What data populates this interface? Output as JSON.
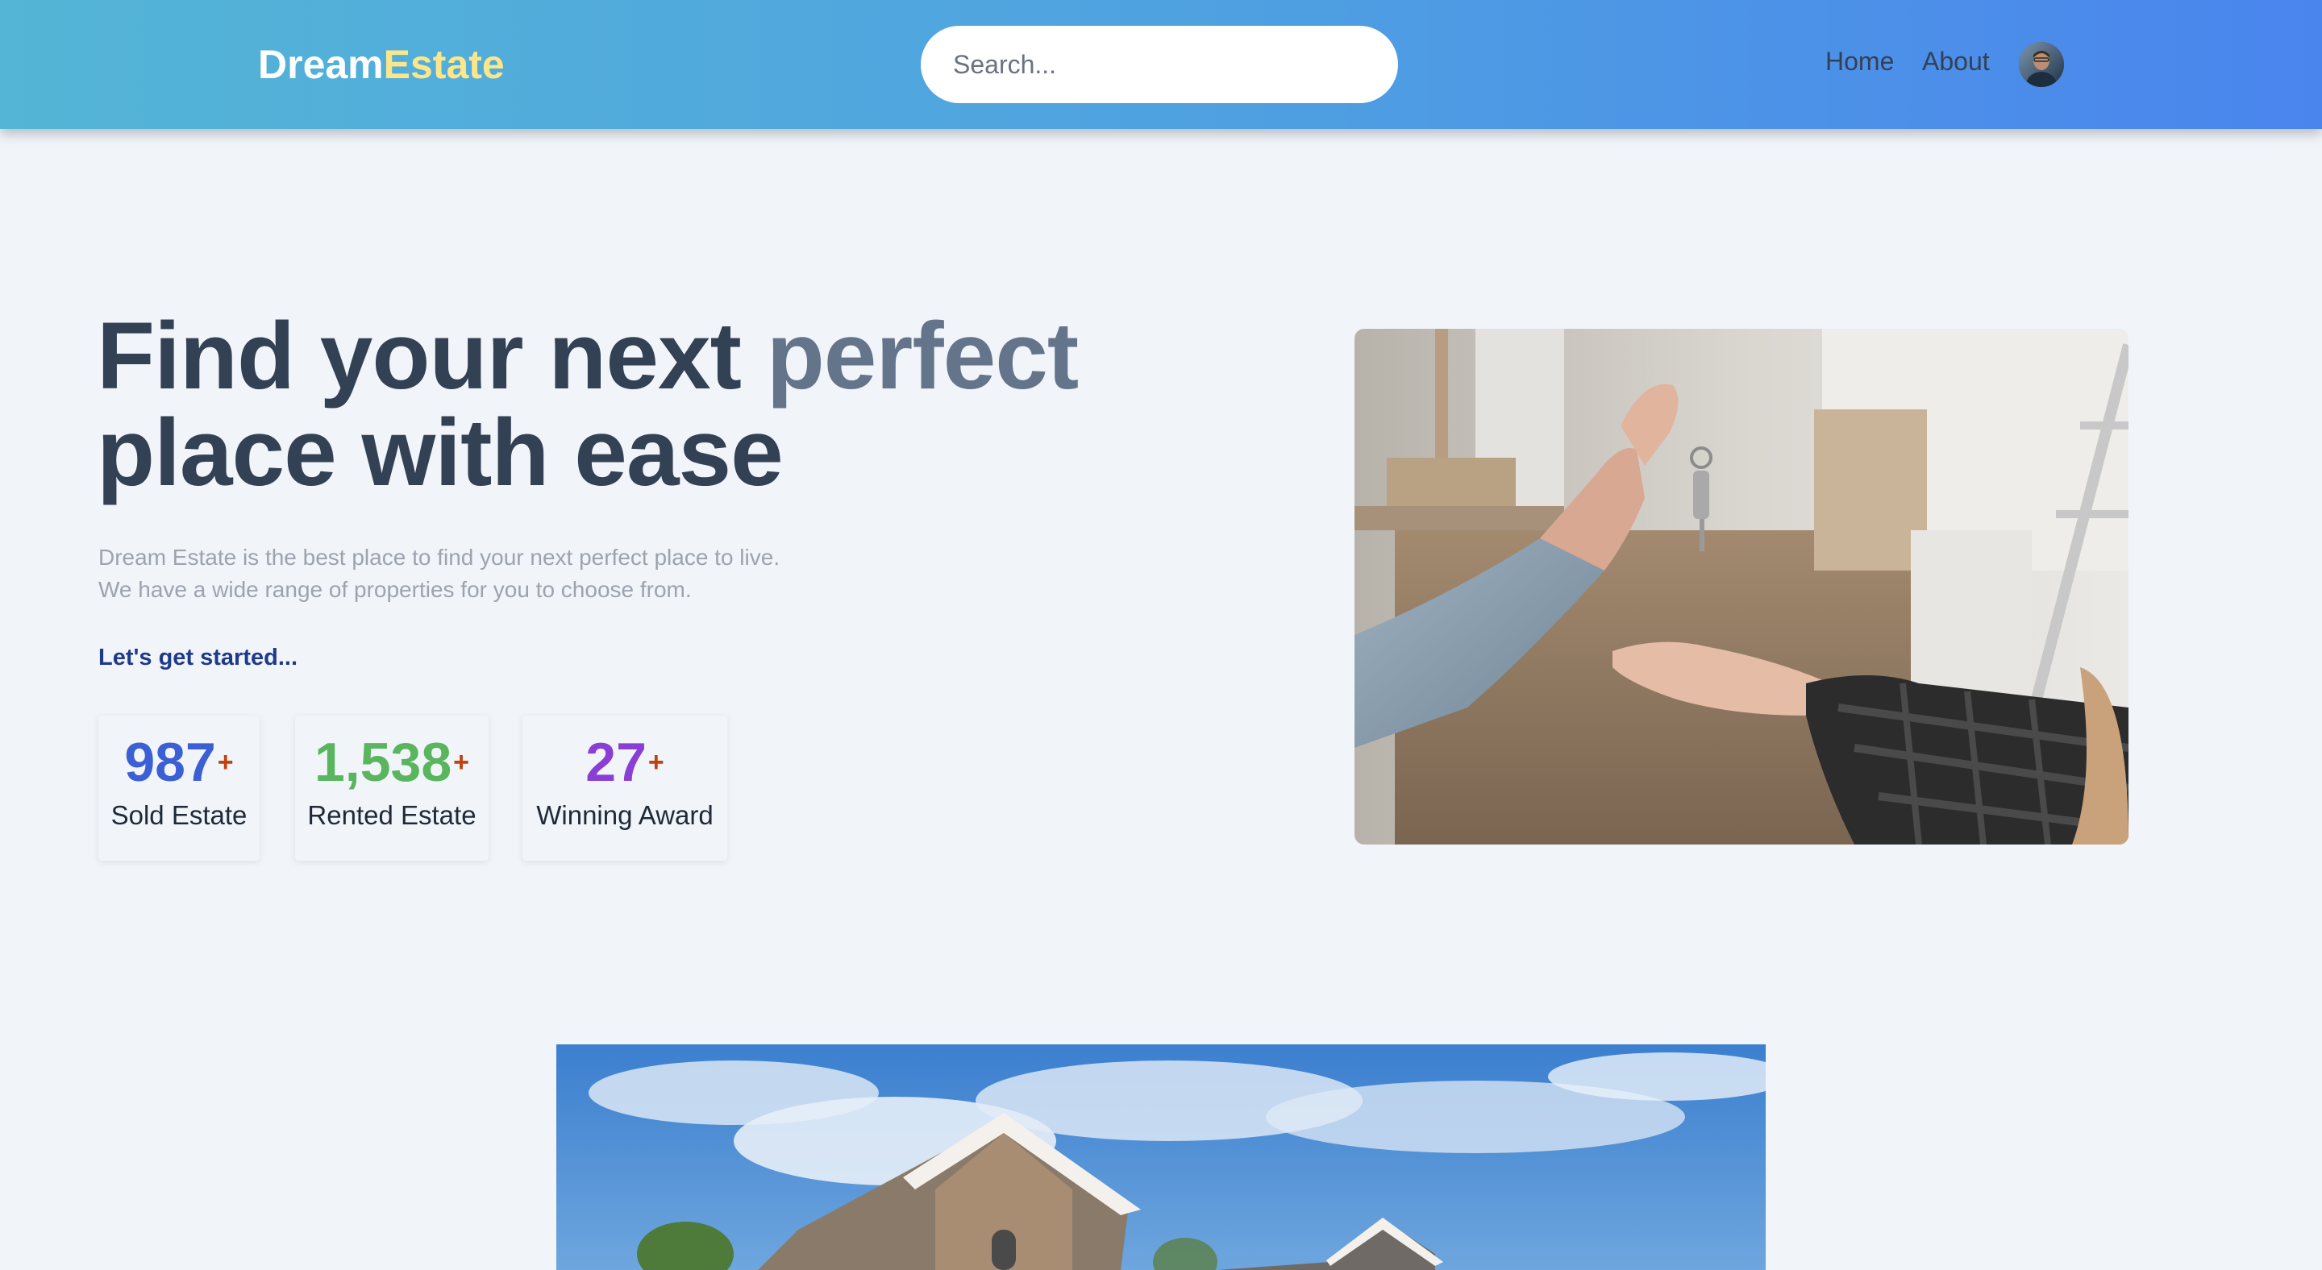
{
  "header": {
    "logo": {
      "part1": "Dream",
      "part2": "Estate"
    },
    "search": {
      "placeholder": "Search..."
    },
    "nav": [
      {
        "label": "Home"
      },
      {
        "label": "About"
      }
    ]
  },
  "hero": {
    "title_line1_main": "Find your next ",
    "title_line1_accent": "perfect",
    "title_line2": "place with ease",
    "description_line1": "Dream Estate is the best place to find your next perfect place to live.",
    "description_line2": "We have a wide range of properties for you to choose from.",
    "cta": "Let's get started...",
    "stats": [
      {
        "value": "987",
        "suffix": "+",
        "label": "Sold Estate"
      },
      {
        "value": "1,538",
        "suffix": "+",
        "label": "Rented Estate"
      },
      {
        "value": "27",
        "suffix": "+",
        "label": "Winning Award"
      }
    ]
  },
  "colors": {
    "logo_accent": "#fde68a",
    "header_gradient_start": "#54b5d6",
    "header_gradient_end": "#4a85ee",
    "stat_sold": "#3b5fd4",
    "stat_rented": "#5ab55f",
    "stat_award": "#8a3fd4",
    "plus": "#c2410c",
    "cta": "#1e3a8a"
  },
  "icons": {
    "search": "search-icon",
    "avatar": "avatar"
  }
}
